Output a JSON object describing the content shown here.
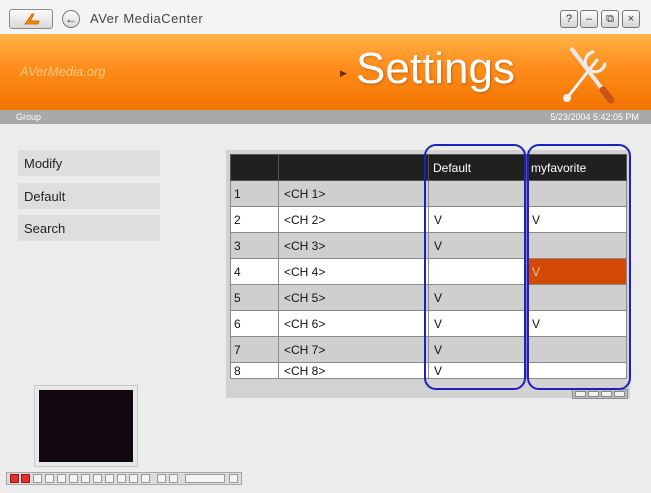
{
  "window": {
    "title": "AVer MediaCenter",
    "back_glyph": "←",
    "buttons": {
      "help": "?",
      "minimize": "–",
      "restore": "⧉",
      "close": "×"
    }
  },
  "banner": {
    "brand": "AVerMedia.org",
    "section_title": "Settings",
    "marker": "▶"
  },
  "status": {
    "group_label": "Group",
    "timestamp": "5/23/2004 5:42:05 PM"
  },
  "menu": {
    "items": [
      {
        "label": "Modify"
      },
      {
        "label": "Default"
      },
      {
        "label": "Search"
      }
    ]
  },
  "table": {
    "headers": [
      "",
      "",
      "Default",
      "myfavorite"
    ],
    "rows": [
      {
        "num": "1",
        "channel": "<CH 1>",
        "default": "",
        "favorite": ""
      },
      {
        "num": "2",
        "channel": "<CH 2>",
        "default": "V",
        "favorite": "V"
      },
      {
        "num": "3",
        "channel": "<CH 3>",
        "default": "V",
        "favorite": ""
      },
      {
        "num": "4",
        "channel": "<CH 4>",
        "default": "",
        "favorite": "V",
        "favorite_highlighted": true
      },
      {
        "num": "5",
        "channel": "<CH 5>",
        "default": "V",
        "favorite": ""
      },
      {
        "num": "6",
        "channel": "<CH 6>",
        "default": "V",
        "favorite": "V"
      },
      {
        "num": "7",
        "channel": "<CH 7>",
        "default": "V",
        "favorite": ""
      },
      {
        "num": "8",
        "channel": "<CH 8>",
        "default": "V",
        "favorite": ""
      }
    ]
  },
  "colors": {
    "banner_orange": "#ff8c1a",
    "favorite_highlight": "#d24a06",
    "annotation_blue": "#2020c0",
    "header_dark": "#202020"
  },
  "icons": {
    "logo": "aver-logo-icon",
    "tools": "wrench-screwdriver-icon"
  }
}
